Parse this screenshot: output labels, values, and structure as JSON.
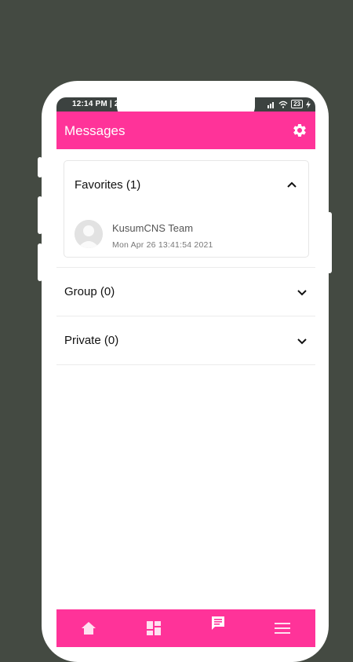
{
  "status_bar": {
    "time": "12:14 PM | 2",
    "battery": "23"
  },
  "header": {
    "title": "Messages",
    "settings_icon": "gear-icon"
  },
  "favorites": {
    "label": "Favorites (1)",
    "expanded": true,
    "items": [
      {
        "name": "KusumCNS Team",
        "timestamp": "Mon Apr 26 13:41:54 2021"
      }
    ]
  },
  "sections": [
    {
      "label": "Group (0)"
    },
    {
      "label": "Private (0)"
    }
  ],
  "bottom_nav": {
    "items": [
      "home-icon",
      "dashboard-icon",
      "messages-icon",
      "menu-icon"
    ]
  },
  "colors": {
    "accent": "#ff3399",
    "background": "#444a42",
    "frame": "#ffffff"
  }
}
